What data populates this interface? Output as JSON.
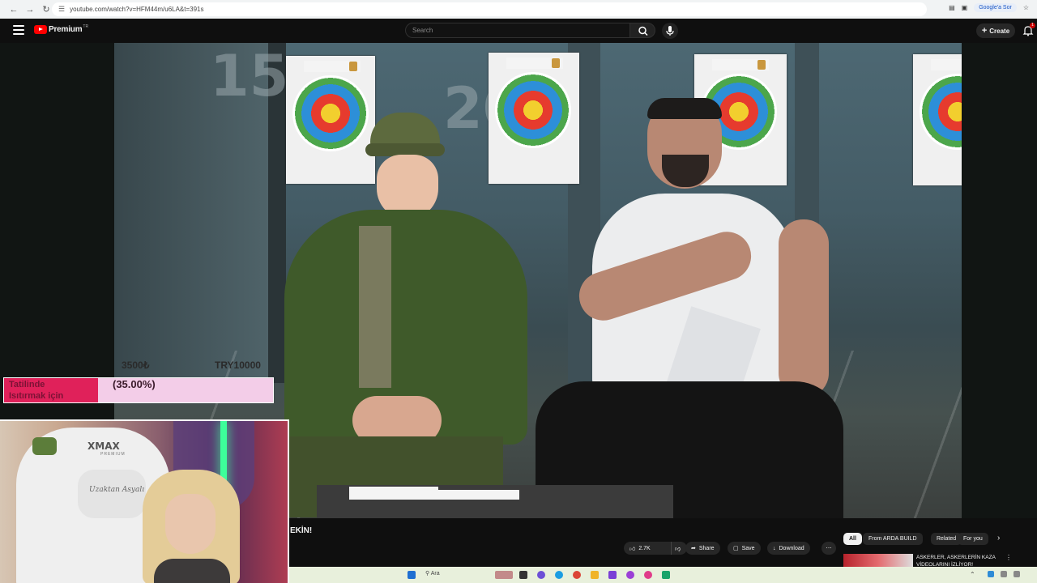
{
  "browser": {
    "url": "youtube.com/watch?v=HFM44m/u6LA&t=391s",
    "google_sor": "Google'a Sor"
  },
  "youtube": {
    "logo_text": "Premium",
    "country": "TR",
    "search_placeholder": "Search",
    "create_label": "Create",
    "notification_count": "1"
  },
  "video": {
    "lane_numbers": [
      "15",
      "20"
    ],
    "title_fragment": "EKİN!"
  },
  "donation_overlay": {
    "amount_left": "3500₺",
    "amount_goal": "TRY10000",
    "label_line1": "Tatilinde",
    "label_line2": "Isıtırmak için",
    "percent_text": "(35.00%)",
    "progress": 0.35,
    "fill_color": "#e0215a",
    "track_color": "#f3cde8"
  },
  "webcam": {
    "chair_brand": "XMAX",
    "chair_sub": "PREMIUM",
    "pillow_text": "Uzaktan Asyalı"
  },
  "actions": {
    "likes": "2.7K",
    "share": "Share",
    "save": "Save",
    "download": "Download"
  },
  "chips": [
    "All",
    "From ARDA BUILD",
    "Related",
    "For you"
  ],
  "recommendation": {
    "title": "ASKERLER, ASKERLERİN KAZA VİDEOLARINI İZLİYOR!"
  },
  "taskbar": {
    "search": "Ara"
  }
}
